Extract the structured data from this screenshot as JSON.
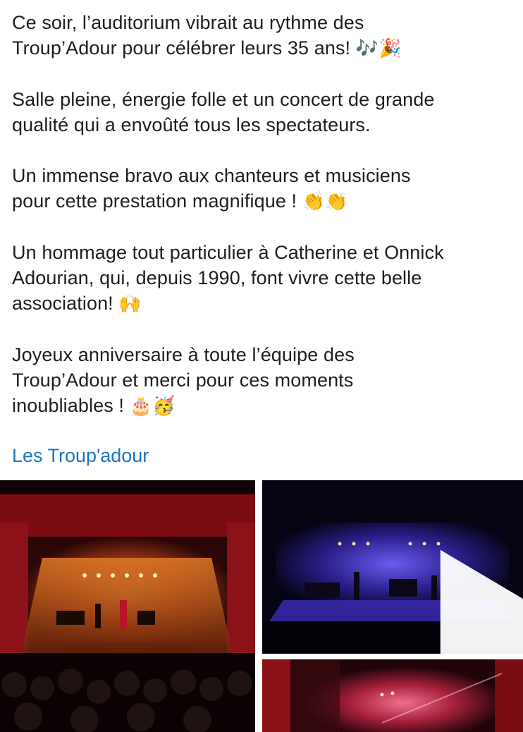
{
  "post": {
    "paragraphs": [
      {
        "lines": [
          "Ce soir, l’auditorium vibrait au rythme des",
          "Troup’Adour pour célébrer leurs 35 ans! "
        ],
        "emoji": "🎶🎉"
      },
      {
        "lines": [
          "Salle pleine, énergie folle et un concert de grande",
          "qualité qui a envoûté tous les spectateurs."
        ],
        "emoji": ""
      },
      {
        "lines": [
          "Un immense bravo aux chanteurs et musiciens",
          "pour cette prestation magnifique ! "
        ],
        "emoji": "👏👏"
      },
      {
        "lines": [
          "Un hommage tout particulier à Catherine et Onnick",
          "Adourian, qui, depuis 1990, font vivre cette belle",
          "association! "
        ],
        "emoji": "🙌"
      },
      {
        "lines": [
          "Joyeux anniversaire à toute l’équipe des",
          "Troup’Adour et merci pour ces moments",
          "inoubliables ! "
        ],
        "emoji": "🎂🥳"
      }
    ],
    "tagged_page": "Les Troup'adour"
  },
  "media": {
    "items": [
      "photo",
      "video",
      "photo"
    ],
    "colors": {
      "stage_red": "#8a1010",
      "stage_orange": "#d9641c",
      "stage_blue": "#3a2aa8",
      "stage_pink": "#c8325a",
      "link_blue": "#1b74c5"
    }
  }
}
